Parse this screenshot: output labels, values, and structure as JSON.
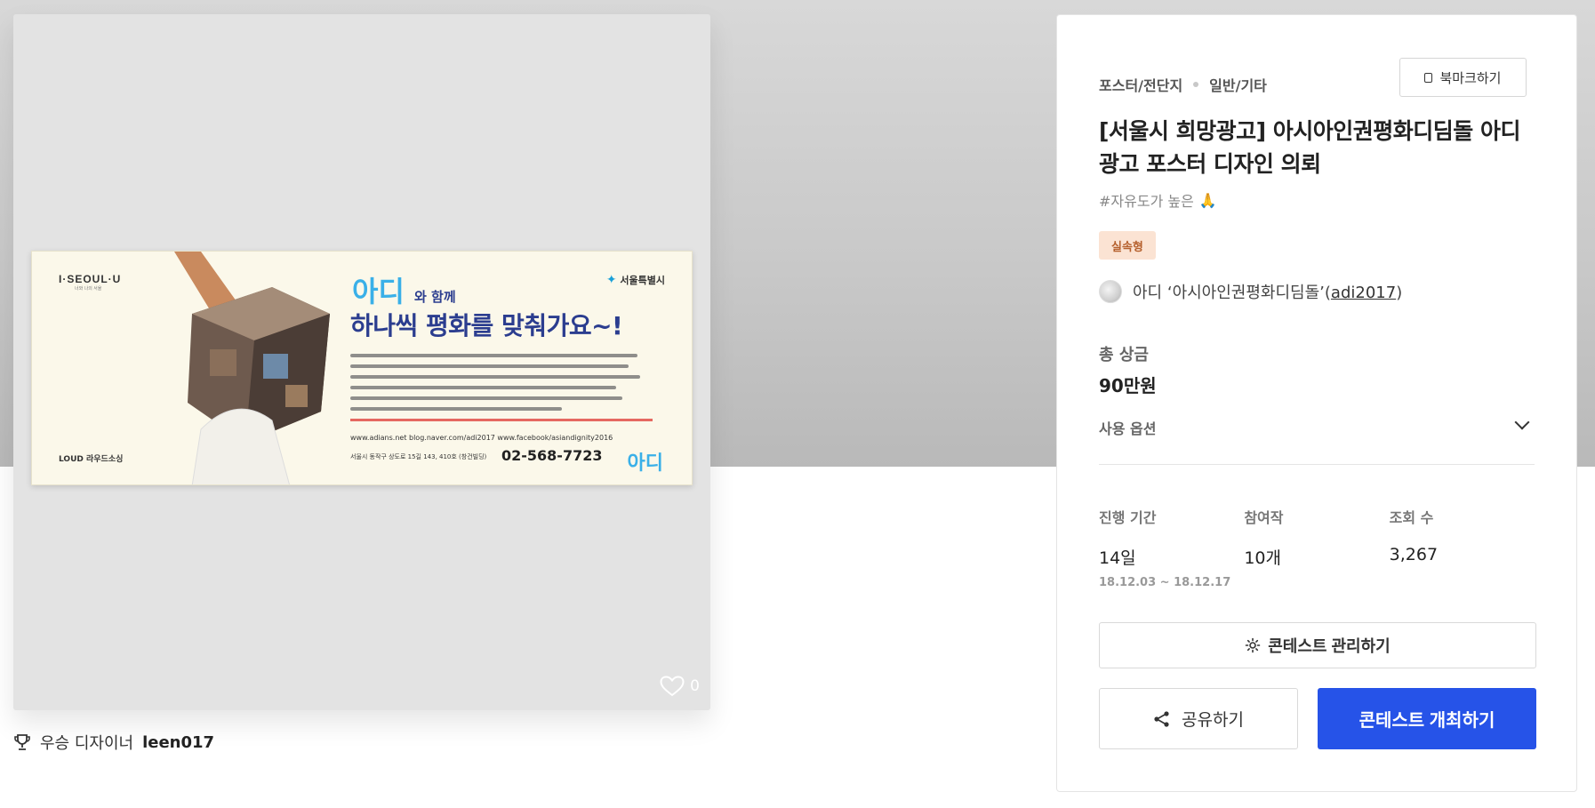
{
  "image": {
    "banner": {
      "seoul_logo": "I·SEOUL·U",
      "seoul_sub": "너와 나의 서울",
      "city_logo": "서울특별시",
      "adi_title": "아디",
      "adi_title_suffix": "와 함께",
      "headline": "하나씩 평화를 맞춰가요~!",
      "contact": "www.adians.net   blog.naver.com/adi2017   www.facebook/asiandignity2016",
      "address": "서울시 동작구 상도로 15길 143, 410호 (창건빌딩)",
      "phone": "02-568-7723",
      "adi_small": "아디",
      "love_logo": "LOUD 라우드소싱"
    },
    "likes": "0"
  },
  "winner": {
    "label": "우승 디자이너",
    "name": "leen017"
  },
  "panel": {
    "breadcrumbs": [
      "포스터/전단지",
      "일반/기타"
    ],
    "bookmark_label": "북마크하기",
    "title": "[서울시 희망광고] 아시아인권평화디딤돌 아디 광고 포스터 디자인 의뢰",
    "tag": "#자유도가 높은",
    "badge": "실속형",
    "host_name": "아디 ‘아시아인권평화디딤돌’",
    "host_id": "adi2017",
    "prize_label": "총 상금",
    "prize_value": "90만원",
    "options_label": "사용 옵션",
    "stats": [
      {
        "label": "진행 기간",
        "value": "14일",
        "sub": "18.12.03  ~  18.12.17"
      },
      {
        "label": "참여작",
        "value": "10개",
        "sub": ""
      },
      {
        "label": "조회 수",
        "value": "3,267",
        "sub": ""
      }
    ],
    "manage_label": "콘테스트 관리하기",
    "share_label": "공유하기",
    "host_contest_label": "콘테스트 개최하기"
  },
  "colors": {
    "primary": "#2653e8",
    "badge_bg": "#fbe3d3",
    "badge_text": "#b5602d"
  }
}
